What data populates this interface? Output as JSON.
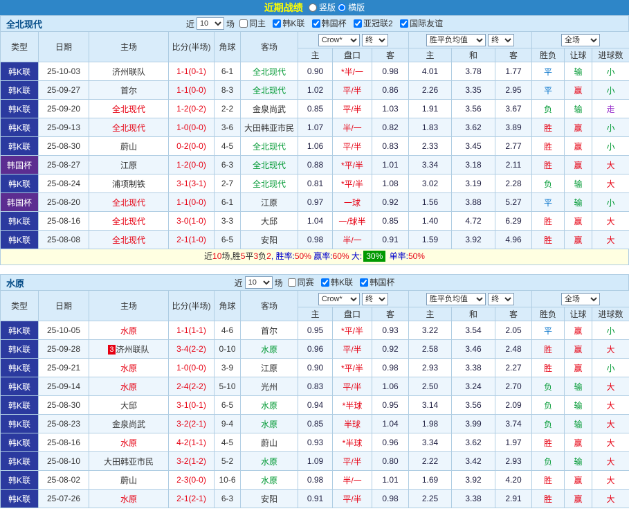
{
  "topbar": {
    "title": "近期战绩",
    "options": [
      {
        "label": "竖版",
        "selected": false
      },
      {
        "label": "横版",
        "selected": true
      }
    ]
  },
  "colors": {
    "topbar": "#2E86C8",
    "title": "#FFFF00",
    "sectionbg": "#D3EAFA",
    "headbg": "#D9ECFA",
    "rowalt": "#EDF6FD",
    "border": "#AFCDE3",
    "league": "#2B3A9F",
    "cup": "#5C2D91",
    "red": "#E60012",
    "green": "#009933",
    "blue": "#0070C9",
    "purple": "#9933CC",
    "badge": "#009900",
    "summarybg": "#FFFFE1"
  },
  "sections": [
    {
      "team": "全北现代",
      "filter": {
        "near_label": "近",
        "count": "10",
        "games_label": "场",
        "checkboxes": [
          {
            "label": "同主",
            "checked": false
          },
          {
            "label": "韩K联",
            "checked": true
          },
          {
            "label": "韩国杯",
            "checked": true
          },
          {
            "label": "亚冠联2",
            "checked": true
          },
          {
            "label": "国际友谊",
            "checked": true
          }
        ]
      },
      "header": {
        "cols": [
          "类型",
          "日期",
          "主场",
          "比分(半场)",
          "角球",
          "客场"
        ],
        "odds_company": "Crow*",
        "odds_final": "终",
        "europe_label": "胜平负均值",
        "europe_final": "终",
        "scope_label": "全场",
        "sub": [
          "主",
          "盘口",
          "客",
          "主",
          "和",
          "客",
          "胜负",
          "让球",
          "进球数"
        ]
      },
      "rows": [
        {
          "type": "韩K联",
          "typeCls": "type-league",
          "date": "25-10-03",
          "home": "济州联队",
          "score": "1-1(0-1)",
          "corner": "6-1",
          "away": "全北现代",
          "awayCls": "t-green",
          "o1": "0.90",
          "hc": "*半/一",
          "o2": "0.98",
          "e1": "4.01",
          "e2": "3.78",
          "e3": "1.77",
          "r1": "平",
          "r1c": "c-blue",
          "r2": "输",
          "r2c": "c-green",
          "r3": "小",
          "r3c": "c-green"
        },
        {
          "type": "韩K联",
          "typeCls": "type-league",
          "date": "25-09-27",
          "home": "首尔",
          "score": "1-1(0-0)",
          "corner": "8-3",
          "away": "全北现代",
          "awayCls": "t-green",
          "o1": "1.02",
          "hc": "平/半",
          "o2": "0.86",
          "e1": "2.26",
          "e2": "3.35",
          "e3": "2.95",
          "r1": "平",
          "r1c": "c-blue",
          "r2": "赢",
          "r2c": "c-red",
          "r3": "小",
          "r3c": "c-green"
        },
        {
          "type": "韩K联",
          "typeCls": "type-league",
          "date": "25-09-20",
          "home": "全北现代",
          "homeCls": "t-red",
          "score": "1-2(0-2)",
          "corner": "2-2",
          "away": "金泉尚武",
          "o1": "0.85",
          "hc": "平/半",
          "o2": "1.03",
          "e1": "1.91",
          "e2": "3.56",
          "e3": "3.67",
          "r1": "负",
          "r1c": "c-green",
          "r2": "输",
          "r2c": "c-green",
          "r3": "走",
          "r3c": "c-purple"
        },
        {
          "type": "韩K联",
          "typeCls": "type-league",
          "date": "25-09-13",
          "home": "全北现代",
          "homeCls": "t-red",
          "score": "1-0(0-0)",
          "corner": "3-6",
          "away": "大田韩亚市民",
          "o1": "1.07",
          "hc": "半/一",
          "o2": "0.82",
          "e1": "1.83",
          "e2": "3.62",
          "e3": "3.89",
          "r1": "胜",
          "r1c": "c-red",
          "r2": "赢",
          "r2c": "c-red",
          "r3": "小",
          "r3c": "c-green"
        },
        {
          "type": "韩K联",
          "typeCls": "type-league",
          "date": "25-08-30",
          "home": "蔚山",
          "score": "0-2(0-0)",
          "corner": "4-5",
          "away": "全北现代",
          "awayCls": "t-green",
          "o1": "1.06",
          "hc": "平/半",
          "o2": "0.83",
          "e1": "2.33",
          "e2": "3.45",
          "e3": "2.77",
          "r1": "胜",
          "r1c": "c-red",
          "r2": "赢",
          "r2c": "c-red",
          "r3": "小",
          "r3c": "c-green"
        },
        {
          "type": "韩国杯",
          "typeCls": "type-cup",
          "date": "25-08-27",
          "home": "江原",
          "score": "1-2(0-0)",
          "corner": "6-3",
          "away": "全北现代",
          "awayCls": "t-green",
          "o1": "0.88",
          "hc": "*平/半",
          "o2": "1.01",
          "e1": "3.34",
          "e2": "3.18",
          "e3": "2.11",
          "r1": "胜",
          "r1c": "c-red",
          "r2": "赢",
          "r2c": "c-red",
          "r3": "大",
          "r3c": "c-red"
        },
        {
          "type": "韩K联",
          "typeCls": "type-league",
          "date": "25-08-24",
          "home": "浦项制铁",
          "score": "3-1(3-1)",
          "corner": "2-7",
          "away": "全北现代",
          "awayCls": "t-green",
          "o1": "0.81",
          "hc": "*平/半",
          "o2": "1.08",
          "e1": "3.02",
          "e2": "3.19",
          "e3": "2.28",
          "r1": "负",
          "r1c": "c-green",
          "r2": "输",
          "r2c": "c-green",
          "r3": "大",
          "r3c": "c-red"
        },
        {
          "type": "韩国杯",
          "typeCls": "type-cup",
          "date": "25-08-20",
          "home": "全北现代",
          "homeCls": "t-red",
          "score": "1-1(0-0)",
          "corner": "6-1",
          "away": "江原",
          "o1": "0.97",
          "hc": "一球",
          "o2": "0.92",
          "e1": "1.56",
          "e2": "3.88",
          "e3": "5.27",
          "r1": "平",
          "r1c": "c-blue",
          "r2": "输",
          "r2c": "c-green",
          "r3": "小",
          "r3c": "c-green"
        },
        {
          "type": "韩K联",
          "typeCls": "type-league",
          "date": "25-08-16",
          "home": "全北现代",
          "homeCls": "t-red",
          "score": "3-0(1-0)",
          "corner": "3-3",
          "away": "大邱",
          "o1": "1.04",
          "hc": "一/球半",
          "o2": "0.85",
          "e1": "1.40",
          "e2": "4.72",
          "e3": "6.29",
          "r1": "胜",
          "r1c": "c-red",
          "r2": "赢",
          "r2c": "c-red",
          "r3": "大",
          "r3c": "c-red"
        },
        {
          "type": "韩K联",
          "typeCls": "type-league",
          "date": "25-08-08",
          "home": "全北现代",
          "homeCls": "t-red",
          "score": "2-1(1-0)",
          "corner": "6-5",
          "away": "安阳",
          "o1": "0.98",
          "hc": "半/一",
          "o2": "0.91",
          "e1": "1.59",
          "e2": "3.92",
          "e3": "4.96",
          "r1": "胜",
          "r1c": "c-red",
          "r2": "赢",
          "r2c": "c-red",
          "r3": "大",
          "r3c": "c-red"
        }
      ],
      "summary": [
        {
          "text": "近",
          "cls": "s-dark"
        },
        {
          "text": "10",
          "cls": "s-red"
        },
        {
          "text": "场,胜",
          "cls": "s-dark"
        },
        {
          "text": "5",
          "cls": "s-red"
        },
        {
          "text": "平",
          "cls": "s-dark"
        },
        {
          "text": "3",
          "cls": "s-red"
        },
        {
          "text": "负",
          "cls": "s-dark"
        },
        {
          "text": "2",
          "cls": "s-red"
        },
        {
          "text": ", 胜率:",
          "cls": "s-blue"
        },
        {
          "text": "50%",
          "cls": "s-red"
        },
        {
          "text": " 赢率:",
          "cls": "s-blue"
        },
        {
          "text": "60%",
          "cls": "s-red"
        },
        {
          "text": " 大:",
          "cls": "s-blue"
        },
        {
          "text": "30%",
          "cls": "badge-green"
        },
        {
          "text": " 单率:",
          "cls": "s-blue"
        },
        {
          "text": "50%",
          "cls": "s-red"
        }
      ]
    },
    {
      "team": "水原",
      "filter": {
        "near_label": "近",
        "count": "10",
        "games_label": "场",
        "checkboxes": [
          {
            "label": "同赛",
            "checked": false
          },
          {
            "label": "韩K联",
            "checked": true
          },
          {
            "label": "韩国杯",
            "checked": true
          }
        ]
      },
      "header": {
        "cols": [
          "类型",
          "日期",
          "主场",
          "比分(半场)",
          "角球",
          "客场"
        ],
        "odds_company": "Crow*",
        "odds_final": "终",
        "europe_label": "胜平负均值",
        "europe_final": "终",
        "scope_label": "全场",
        "sub": [
          "主",
          "盘口",
          "客",
          "主",
          "和",
          "客",
          "胜负",
          "让球",
          "进球数"
        ]
      },
      "rows": [
        {
          "type": "韩K联",
          "typeCls": "type-league",
          "date": "25-10-05",
          "home": "水原",
          "homeCls": "t-red",
          "score": "1-1(1-1)",
          "corner": "4-6",
          "away": "首尔",
          "o1": "0.95",
          "hc": "*平/半",
          "o2": "0.93",
          "e1": "3.22",
          "e2": "3.54",
          "e3": "2.05",
          "r1": "平",
          "r1c": "c-blue",
          "r2": "赢",
          "r2c": "c-red",
          "r3": "小",
          "r3c": "c-green"
        },
        {
          "type": "韩K联",
          "typeCls": "type-league",
          "date": "25-09-28",
          "homeBadge": "3",
          "home": "济州联队",
          "score": "3-4(2-2)",
          "corner": "0-10",
          "away": "水原",
          "awayCls": "t-green",
          "o1": "0.96",
          "hc": "平/半",
          "o2": "0.92",
          "e1": "2.58",
          "e2": "3.46",
          "e3": "2.48",
          "r1": "胜",
          "r1c": "c-red",
          "r2": "赢",
          "r2c": "c-red",
          "r3": "大",
          "r3c": "c-red"
        },
        {
          "type": "韩K联",
          "typeCls": "type-league",
          "date": "25-09-21",
          "home": "水原",
          "homeCls": "t-red",
          "score": "1-0(0-0)",
          "corner": "3-9",
          "away": "江原",
          "o1": "0.90",
          "hc": "*平/半",
          "o2": "0.98",
          "e1": "2.93",
          "e2": "3.38",
          "e3": "2.27",
          "r1": "胜",
          "r1c": "c-red",
          "r2": "赢",
          "r2c": "c-red",
          "r3": "小",
          "r3c": "c-green"
        },
        {
          "type": "韩K联",
          "typeCls": "type-league",
          "date": "25-09-14",
          "home": "水原",
          "homeCls": "t-red",
          "score": "2-4(2-2)",
          "corner": "5-10",
          "away": "光州",
          "o1": "0.83",
          "hc": "平/半",
          "o2": "1.06",
          "e1": "2.50",
          "e2": "3.24",
          "e3": "2.70",
          "r1": "负",
          "r1c": "c-green",
          "r2": "输",
          "r2c": "c-green",
          "r3": "大",
          "r3c": "c-red"
        },
        {
          "type": "韩K联",
          "typeCls": "type-league",
          "date": "25-08-30",
          "home": "大邱",
          "score": "3-1(0-1)",
          "corner": "6-5",
          "away": "水原",
          "awayCls": "t-green",
          "o1": "0.94",
          "hc": "*半球",
          "o2": "0.95",
          "e1": "3.14",
          "e2": "3.56",
          "e3": "2.09",
          "r1": "负",
          "r1c": "c-green",
          "r2": "输",
          "r2c": "c-green",
          "r3": "大",
          "r3c": "c-red"
        },
        {
          "type": "韩K联",
          "typeCls": "type-league",
          "date": "25-08-23",
          "home": "金泉尚武",
          "score": "3-2(2-1)",
          "corner": "9-4",
          "away": "水原",
          "awayCls": "t-green",
          "o1": "0.85",
          "hc": "半球",
          "o2": "1.04",
          "e1": "1.98",
          "e2": "3.99",
          "e3": "3.74",
          "r1": "负",
          "r1c": "c-green",
          "r2": "输",
          "r2c": "c-green",
          "r3": "大",
          "r3c": "c-red"
        },
        {
          "type": "韩K联",
          "typeCls": "type-league",
          "date": "25-08-16",
          "home": "水原",
          "homeCls": "t-red",
          "score": "4-2(1-1)",
          "corner": "4-5",
          "away": "蔚山",
          "o1": "0.93",
          "hc": "*半球",
          "o2": "0.96",
          "e1": "3.34",
          "e2": "3.62",
          "e3": "1.97",
          "r1": "胜",
          "r1c": "c-red",
          "r2": "赢",
          "r2c": "c-red",
          "r3": "大",
          "r3c": "c-red"
        },
        {
          "type": "韩K联",
          "typeCls": "type-league",
          "date": "25-08-10",
          "home": "大田韩亚市民",
          "score": "3-2(1-2)",
          "corner": "5-2",
          "away": "水原",
          "awayCls": "t-green",
          "o1": "1.09",
          "hc": "平/半",
          "o2": "0.80",
          "e1": "2.22",
          "e2": "3.42",
          "e3": "2.93",
          "r1": "负",
          "r1c": "c-green",
          "r2": "输",
          "r2c": "c-green",
          "r3": "大",
          "r3c": "c-red"
        },
        {
          "type": "韩K联",
          "typeCls": "type-league",
          "date": "25-08-02",
          "home": "蔚山",
          "score": "2-3(0-0)",
          "corner": "10-6",
          "away": "水原",
          "awayCls": "t-green",
          "o1": "0.98",
          "hc": "半/一",
          "o2": "1.01",
          "e1": "1.69",
          "e2": "3.92",
          "e3": "4.20",
          "r1": "胜",
          "r1c": "c-red",
          "r2": "赢",
          "r2c": "c-red",
          "r3": "大",
          "r3c": "c-red"
        },
        {
          "type": "韩K联",
          "typeCls": "type-league",
          "date": "25-07-26",
          "home": "水原",
          "homeCls": "t-red",
          "score": "2-1(2-1)",
          "corner": "6-3",
          "away": "安阳",
          "o1": "0.91",
          "hc": "平/半",
          "o2": "0.98",
          "e1": "2.25",
          "e2": "3.38",
          "e3": "2.91",
          "r1": "胜",
          "r1c": "c-red",
          "r2": "赢",
          "r2c": "c-red",
          "r3": "大",
          "r3c": "c-red"
        }
      ]
    }
  ]
}
